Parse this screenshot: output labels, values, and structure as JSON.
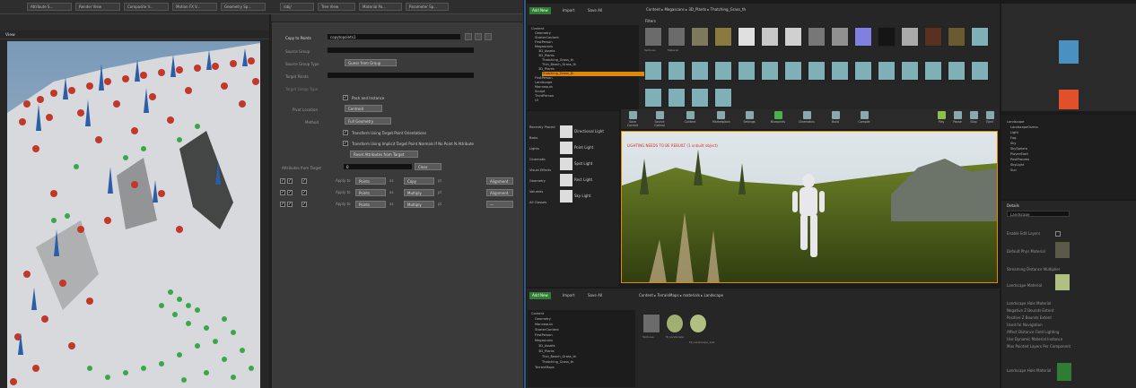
{
  "houdini_tabs": [
    "Attribute S...",
    "Render View",
    "Composite V...",
    "Motion FX V...",
    "Geometry Sp...",
    "/obj/",
    "Tree View",
    "Material Pa...",
    "Parameter Sp..."
  ],
  "viewport": {
    "label": "View"
  },
  "params": {
    "copy_label": "Copy to Points",
    "copy_value": "copytopoints1",
    "rows": [
      {
        "label": "Source Group",
        "value": ""
      },
      {
        "label": "Source Group Type",
        "value": "Guess from Group"
      },
      {
        "label": "Target Points",
        "value": ""
      },
      {
        "label": "Target Group Type",
        "value": ""
      }
    ],
    "pack_label": "Pack and Instance",
    "pivot_label": "Pivot Location",
    "pivot_value": "Centroid",
    "method_label": "Method",
    "method_value": "Full Geometry",
    "chk1": "Transform Using Target Point Orientations",
    "chk2": "Transform Using Implicit Target Point Normals If No Point N Attribute",
    "reset_btn": "Reset Attributes from Target",
    "attr_target_label": "Attributes from Target",
    "attr_target_value": "0",
    "attr_target_btn": "Clear",
    "attr_rows": [
      {
        "label": "Apply to",
        "op1": "Points",
        "mode": "Copy",
        "name1": "pt",
        "op2": "Multiply",
        "name2": "Alignment"
      },
      {
        "label": "Apply to",
        "op1": "Points",
        "mode": "Multiply",
        "name1": "pt",
        "op2": "Multiply",
        "name2": "Alignment"
      },
      {
        "label": "Apply to",
        "op1": "Points",
        "mode": "Multiply",
        "name1": "pt",
        "op2": "Setting",
        "name2": "—"
      }
    ]
  },
  "ue": {
    "add_new": "Add New",
    "import": "Import",
    "save_all": "Save All",
    "path_top": [
      "Content",
      "Megascans",
      "3D_Plants",
      "Thatching_Grass_th"
    ],
    "filters": "Filters",
    "search_placeholder": "Search Thatching_Grass_th",
    "tree_top": [
      "Content",
      "Geometry",
      "StarterContent",
      "FirstPerson",
      "Megascans",
      "3D_Assets",
      "3D_Plants",
      "Thatching_Grass_th",
      "Thin_Beach_Grass_th",
      "3D_Plants",
      "Thatching_Grass_th",
      "FirstPerson",
      "Landscape",
      "Mannequin",
      "Sculpt",
      "ThirdPerson",
      "UI",
      "Map",
      "Sculpt"
    ],
    "thumb_labels": [
      "Textures",
      "Material",
      "Thatching_Grass",
      "Thatching_Grass",
      "Thatching_Grass",
      "Thatching_Grass",
      "Thatching_Grass",
      "Thatching_Grass",
      "Thatching_Grass",
      "Thatching_Grass",
      "Thatching_Grass",
      "Thatching_Grass",
      "Thatching_Grass",
      "Thatching_Grass",
      "Thatching_Grass"
    ],
    "place_items": [
      "Directional Light",
      "Point Light",
      "Spot Light",
      "Rect Light",
      "Sky Light"
    ],
    "place_cats": [
      "Recently Placed",
      "Basic",
      "Lights",
      "Cinematic",
      "Visual Effects",
      "Geometry",
      "Volumes",
      "All Classes"
    ],
    "toolbar": [
      "Save Current",
      "Source Control",
      "Content",
      "Marketplace",
      "Settings",
      "Blueprints",
      "Cinematics",
      "Build",
      "Compile",
      "Play",
      "Pause",
      "Stop",
      "Eject"
    ],
    "vp_warning": "LIGHTING NEEDS TO BE REBUILT (1 unbuilt object)",
    "path_bottom": [
      "Content",
      "TerrainMaps",
      "materials",
      "Landscape"
    ],
    "tree_bottom": [
      "Content",
      "Geometry",
      "Mannequin",
      "StarterContent",
      "FirstPerson",
      "Megascans",
      "3D_Assets",
      "3D_Plants",
      "Thin_Beach_Grass_th",
      "Thatching_Grass_th",
      "TerrainMaps"
    ],
    "bottom_assets": [
      "Textures",
      "M_Landscape",
      "MI_Landscape_Inst"
    ],
    "outliner_items": [
      "Landscape",
      "LandscapeGizmo",
      "Light",
      "Fog",
      "Sky",
      "SkySphere",
      "PlayerStart",
      "PostProcess",
      "SkyLight",
      "Sun"
    ],
    "details_title": "Details",
    "details_search": "Landscape",
    "detail_rows": [
      "Enable Edit Layers",
      "Default Phys Material",
      "Streaming Distance Multiplier",
      "Landscape Material",
      "Landscape Hole Material",
      "Negative Z Bounds Extent",
      "Positive Z Bounds Extent",
      "Used for Navigation",
      "Affect Distance Field Lighting",
      "Use Dynamic Material Instance",
      "Max Painted Layers Per Component"
    ],
    "landscape_hole": "Landscape Hole Material"
  },
  "colors": {
    "accent_green": "#2e7d32",
    "selected_orange": "#e08a00",
    "ue_blue": "#2c5a8f"
  }
}
